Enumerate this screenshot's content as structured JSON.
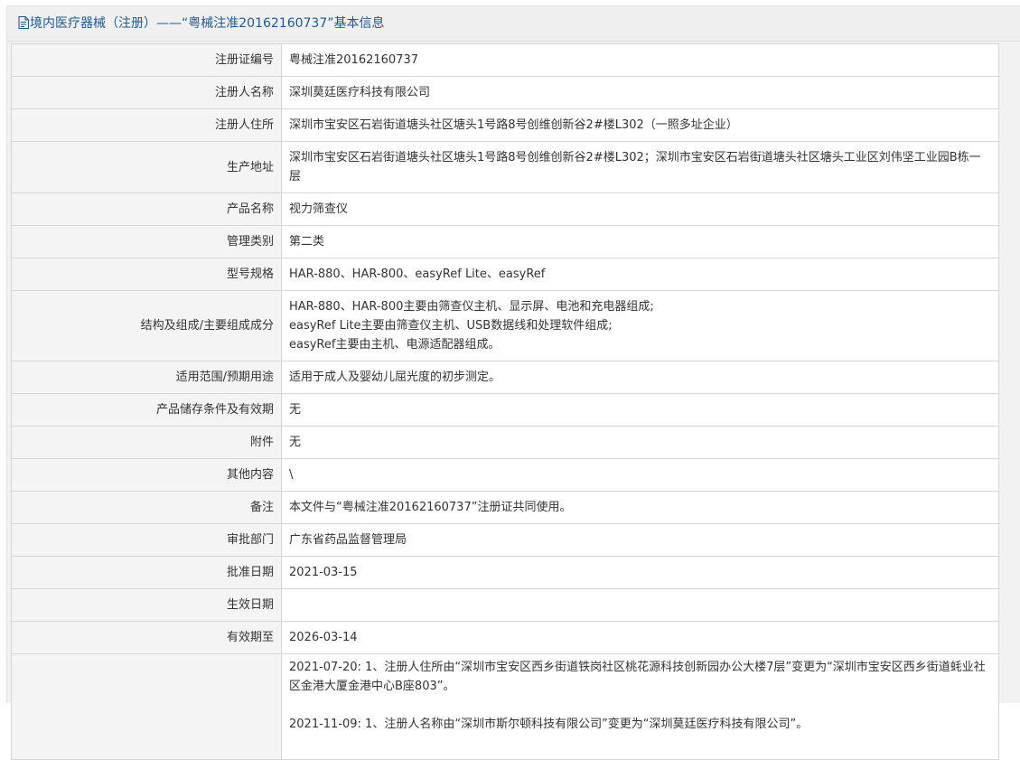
{
  "header": {
    "title": "境内医疗器械（注册）——“粤械注准20162160737”基本信息"
  },
  "fields": [
    {
      "label": "注册证编号",
      "value": "粤械注准20162160737"
    },
    {
      "label": "注册人名称",
      "value": "深圳莫廷医疗科技有限公司"
    },
    {
      "label": "注册人住所",
      "value": "深圳市宝安区石岩街道塘头社区塘头1号路8号创维创新谷2#楼L302（一照多址企业）"
    },
    {
      "label": "生产地址",
      "value": "深圳市宝安区石岩街道塘头社区塘头1号路8号创维创新谷2#楼L302；深圳市宝安区石岩街道塘头社区塘头工业区刘伟坚工业园B栋一层"
    },
    {
      "label": "产品名称",
      "value": "视力筛查仪"
    },
    {
      "label": "管理类别",
      "value": "第二类"
    },
    {
      "label": "型号规格",
      "value": "HAR-880、HAR-800、easyRef Lite、easyRef"
    },
    {
      "label": "结构及组成/主要组成成分",
      "lines": [
        "HAR-880、HAR-800主要由筛查仪主机、显示屏、电池和充电器组成;",
        "easyRef Lite主要由筛查仪主机、USB数据线和处理软件组成;",
        "easyRef主要由主机、电源适配器组成。"
      ]
    },
    {
      "label": "适用范围/预期用途",
      "value": "适用于成人及婴幼儿屈光度的初步测定。"
    },
    {
      "label": "产品储存条件及有效期",
      "value": "无"
    },
    {
      "label": "附件",
      "value": "无"
    },
    {
      "label": "其他内容",
      "value": "\\"
    },
    {
      "label": "备注",
      "value": "本文件与“粤械注准20162160737”注册证共同使用。"
    },
    {
      "label": "审批部门",
      "value": "广东省药品监督管理局"
    },
    {
      "label": "批准日期",
      "value": "2021-03-15"
    },
    {
      "label": "生效日期",
      "value": ""
    },
    {
      "label": "有效期至",
      "value": "2026-03-14"
    }
  ],
  "changes": [
    "2021-07-20: 1、注册人住所由“深圳市宝安区西乡街道铁岗社区桃花源科技创新园办公大楼7层”变更为“深圳市宝安区西乡街道蚝业社区金港大厦金港中心B座803”。",
    "2021-11-09: 1、注册人名称由“深圳市斯尔顿科技有限公司”变更为“深圳莫廷医疗科技有限公司”。"
  ],
  "colors": {
    "header_text": "#1a5a96",
    "label_bg": "#f4f4f4",
    "border": "#d6d6d6"
  },
  "icons": {
    "header": "document-icon"
  }
}
